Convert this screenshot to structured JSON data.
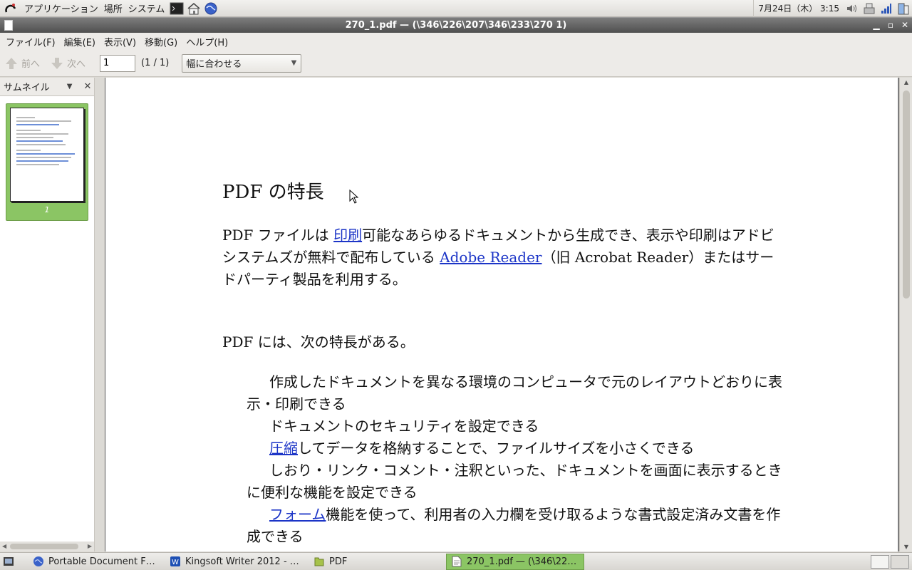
{
  "top_panel": {
    "menu": [
      "アプリケーション",
      "場所",
      "システム"
    ],
    "clock": "7月24日（木） 3:15"
  },
  "window": {
    "title": "270_1.pdf — (\\346\\226\\207\\346\\233\\270 1)"
  },
  "menubar": [
    "ファイル(F)",
    "編集(E)",
    "表示(V)",
    "移動(G)",
    "ヘルプ(H)"
  ],
  "toolbar": {
    "prev_label": "前へ",
    "next_label": "次へ",
    "page_value": "1",
    "page_count": "(1 / 1)",
    "zoom_value": "幅に合わせる"
  },
  "sidebar": {
    "title": "サムネイル",
    "thumb_label": "1"
  },
  "document": {
    "title": "PDF の特長",
    "p1_a": "PDF ファイルは ",
    "p1_link1": "印刷",
    "p1_b": "可能なあらゆるドキュメントから生成でき、表示や印刷はアドビシステムズが無料で配布している ",
    "p1_link2": "Adobe Reader",
    "p1_c": "（旧 Acrobat Reader）またはサードパーティ製品を利用する。",
    "p2": "PDF には、次の特長がある。",
    "items": [
      {
        "pre": "",
        "link": "",
        "text": "作成したドキュメントを異なる環境のコンピュータで元のレイアウトどおりに表示・印刷できる"
      },
      {
        "pre": "",
        "link": "",
        "text": "ドキュメントのセキュリティを設定できる"
      },
      {
        "pre": "",
        "link": "圧縮",
        "text": "してデータを格納することで、ファイルサイズを小さくできる"
      },
      {
        "pre": "",
        "link": "",
        "text": "しおり・リンク・コメント・注釈といった、ドキュメントを画面に表示するときに便利な機能を設定できる"
      },
      {
        "pre": "",
        "link": "フォーム",
        "text": "機能を使って、利用者の入力欄を受け取るような書式設定済み文書を作成できる"
      }
    ]
  },
  "taskbar": [
    {
      "label": "Portable Document F…",
      "icon": "globe-icon",
      "active": false
    },
    {
      "label": "Kingsoft Writer 2012 - …",
      "icon": "writer-icon",
      "active": false
    },
    {
      "label": "PDF",
      "icon": "folder-icon",
      "active": false
    },
    {
      "label": "270_1.pdf — (\\346\\22…",
      "icon": "document-icon",
      "active": true
    }
  ],
  "colors": {
    "accent_green": "#8bc564",
    "link_blue": "#1c35c7"
  }
}
